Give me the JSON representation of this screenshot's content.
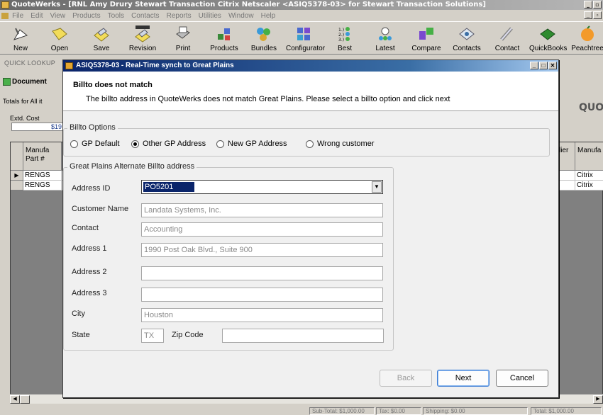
{
  "app": {
    "title": "QuoteWerks - [RNL Amy Drury Stewart Transaction Citrix Netscaler <ASIQ5378-03> for Stewart Transaction Solutions]",
    "menu": [
      "File",
      "Edit",
      "View",
      "Products",
      "Tools",
      "Contacts",
      "Reports",
      "Utilities",
      "Window",
      "Help"
    ],
    "toolbar": [
      {
        "label": "New",
        "icon": "new-icon"
      },
      {
        "label": "Open",
        "icon": "open-icon"
      },
      {
        "label": "Save",
        "icon": "save-icon"
      },
      {
        "label": "Revision",
        "icon": "revision-icon",
        "badge": "REVISION"
      },
      {
        "label": "Print",
        "icon": "print-icon"
      },
      {
        "label": "Products",
        "icon": "products-icon"
      },
      {
        "label": "Bundles",
        "icon": "bundles-icon"
      },
      {
        "label": "Configurator",
        "icon": "configurator-icon"
      },
      {
        "label": "Best",
        "icon": "best-icon"
      },
      {
        "label": "Latest",
        "icon": "latest-icon"
      },
      {
        "label": "Compare",
        "icon": "compare-icon"
      },
      {
        "label": "Contacts",
        "icon": "contacts-icon"
      },
      {
        "label": "Contact",
        "icon": "contact-icon"
      },
      {
        "label": "QuickBooks",
        "icon": "quickbooks-icon"
      },
      {
        "label": "Peachtree",
        "icon": "peachtree-icon"
      }
    ],
    "quick_lookup": "QUICK LOOKUP",
    "document_tab": "Document",
    "totals_label": "Totals for All it",
    "extd_cost_label": "Extd. Cost",
    "extd_cost_value": "$19",
    "right_heading": "QUOTI",
    "grid": {
      "left_header": "Manufa\nPart #",
      "vendor_header": "lier",
      "manuf_header": "Manufa",
      "rows": [
        {
          "part": "RENGS",
          "manuf": "Citrix",
          "current": true
        },
        {
          "part": "RENGS",
          "manuf": "Citrix",
          "current": false
        }
      ]
    },
    "status": [
      "Sub-Total: $1,000.00",
      "Tax: $0.00",
      "Shipping: $0.00",
      "Total: $1,000.00"
    ]
  },
  "dialog": {
    "title": "ASIQ5378-03 - Real-Time synch to Great Plains",
    "heading": "Billto does not match",
    "message": "The billto address in QuoteWerks does not match Great Plains.  Please select a billto option and click next",
    "billto_options_label": "Billto Options",
    "options": [
      {
        "label": "GP Default",
        "selected": false
      },
      {
        "label": "Other GP Address",
        "selected": true
      },
      {
        "label": "New GP Address",
        "selected": false
      },
      {
        "label": "Wrong customer",
        "selected": false
      }
    ],
    "alt_address_label": "Great Plains Alternate Billto address",
    "fields": {
      "address_id": {
        "label": "Address ID",
        "value": "PO5201"
      },
      "customer_name": {
        "label": "Customer Name",
        "value": "Landata Systems, Inc."
      },
      "contact": {
        "label": "Contact",
        "value": "Accounting"
      },
      "address1": {
        "label": "Address 1",
        "value": "1990 Post Oak Blvd., Suite 900"
      },
      "address2": {
        "label": "Address 2",
        "value": ""
      },
      "address3": {
        "label": "Address 3",
        "value": ""
      },
      "city": {
        "label": "City",
        "value": "Houston"
      },
      "state": {
        "label": "State",
        "value": "TX"
      },
      "zip": {
        "label": "Zip Code",
        "value": ""
      }
    },
    "buttons": {
      "back": "Back",
      "next": "Next",
      "cancel": "Cancel"
    }
  }
}
